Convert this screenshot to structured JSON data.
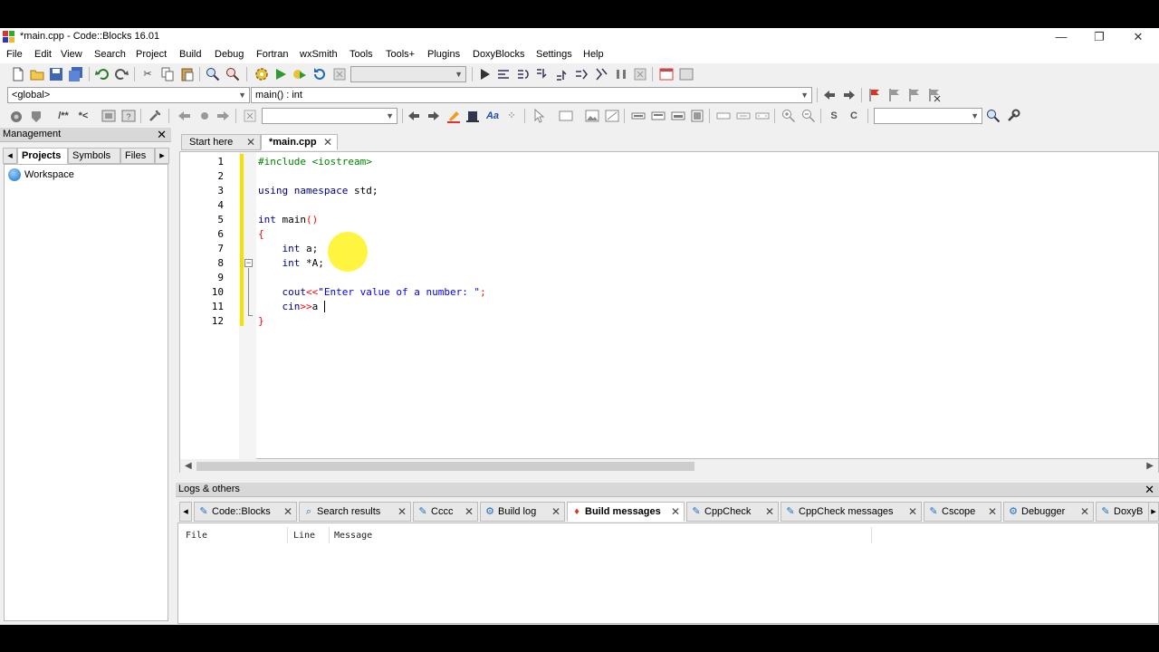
{
  "window": {
    "title": "*main.cpp - Code::Blocks 16.01",
    "minimize": "—",
    "restore": "❐",
    "close": "✕"
  },
  "menu": [
    "File",
    "Edit",
    "View",
    "Search",
    "Project",
    "Build",
    "Debug",
    "Fortran",
    "wxSmith",
    "Tools",
    "Tools+",
    "Plugins",
    "DoxyBlocks",
    "Settings",
    "Help"
  ],
  "code_nav": {
    "scope": "<global>",
    "symbol": "main() : int"
  },
  "management": {
    "title": "Management",
    "tabs": [
      "Projects",
      "Symbols",
      "Files"
    ],
    "active_tab": "Projects",
    "tree": [
      "Workspace"
    ]
  },
  "editor": {
    "tabs": [
      {
        "label": "Start here",
        "active": false
      },
      {
        "label": "*main.cpp",
        "active": true
      }
    ],
    "line_numbers": [
      "1",
      "2",
      "3",
      "4",
      "5",
      "6",
      "7",
      "8",
      "9",
      "10",
      "11",
      "12"
    ],
    "lines": {
      "l1": "#include <iostream>",
      "l3a": "using namespace",
      "l3b": "std;",
      "l5a": "int",
      "l5b": "main",
      "l5c": "()",
      "l6": "{",
      "l7a": "int",
      "l7b": "a;",
      "l8a": "int",
      "l8b": "*A;",
      "l10a": "cout",
      "l10b": "<<",
      "l10c": "\"Enter value of a number: \"",
      "l10d": ";",
      "l11a": "cin",
      "l11b": ">>",
      "l11c": "a",
      "l12": "}"
    }
  },
  "logs": {
    "title": "Logs & others",
    "tabs": [
      {
        "label": "Code::Blocks",
        "icon": "✎"
      },
      {
        "label": "Search results",
        "icon": "⌕"
      },
      {
        "label": "Cccc",
        "icon": "✎"
      },
      {
        "label": "Build log",
        "icon": "⚙"
      },
      {
        "label": "Build messages",
        "icon": "♦"
      },
      {
        "label": "CppCheck",
        "icon": "✎"
      },
      {
        "label": "CppCheck messages",
        "icon": "✎"
      },
      {
        "label": "Cscope",
        "icon": "✎"
      },
      {
        "label": "Debugger",
        "icon": "⚙"
      },
      {
        "label": "DoxyB",
        "icon": "✎"
      }
    ],
    "active_tab": "Build messages",
    "columns": [
      "File",
      "Line",
      "Message"
    ]
  }
}
